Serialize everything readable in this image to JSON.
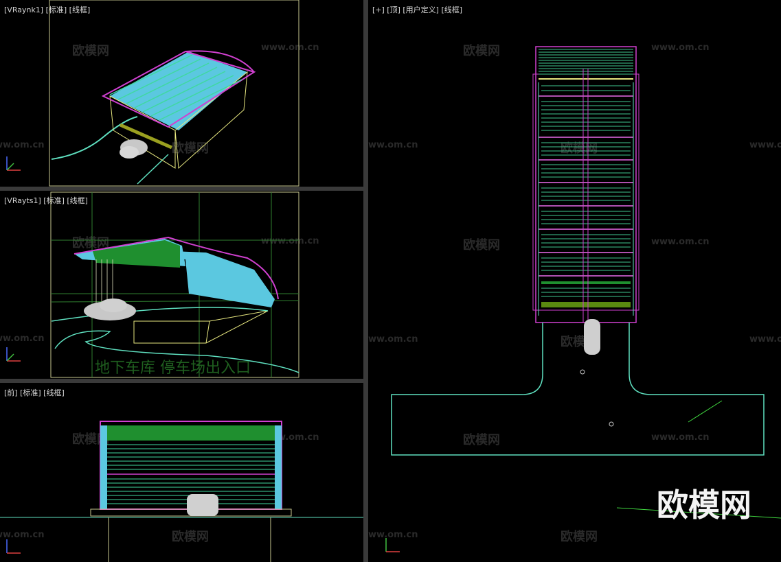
{
  "viewports": {
    "vraynk": {
      "label": "[VRaynk1] [标准] [线框]"
    },
    "vrayts": {
      "label": "[VRayts1] [标准] [线框]"
    },
    "front": {
      "label": "[前] [标准] [线框]"
    },
    "top": {
      "label": "[+] [顶] [用户定义] [线框]"
    }
  },
  "watermark": {
    "brand": "欧模网",
    "url": "www.om.cn"
  },
  "caption": "地下车库 停车场出入口",
  "axes": {
    "x": "x",
    "y": "y",
    "z": "z"
  },
  "colors": {
    "cyan": "#5bc8e0",
    "magenta": "#d040d0",
    "green": "#1f8f2f",
    "yellow": "#e0e070",
    "teal": "#40e0c0"
  }
}
